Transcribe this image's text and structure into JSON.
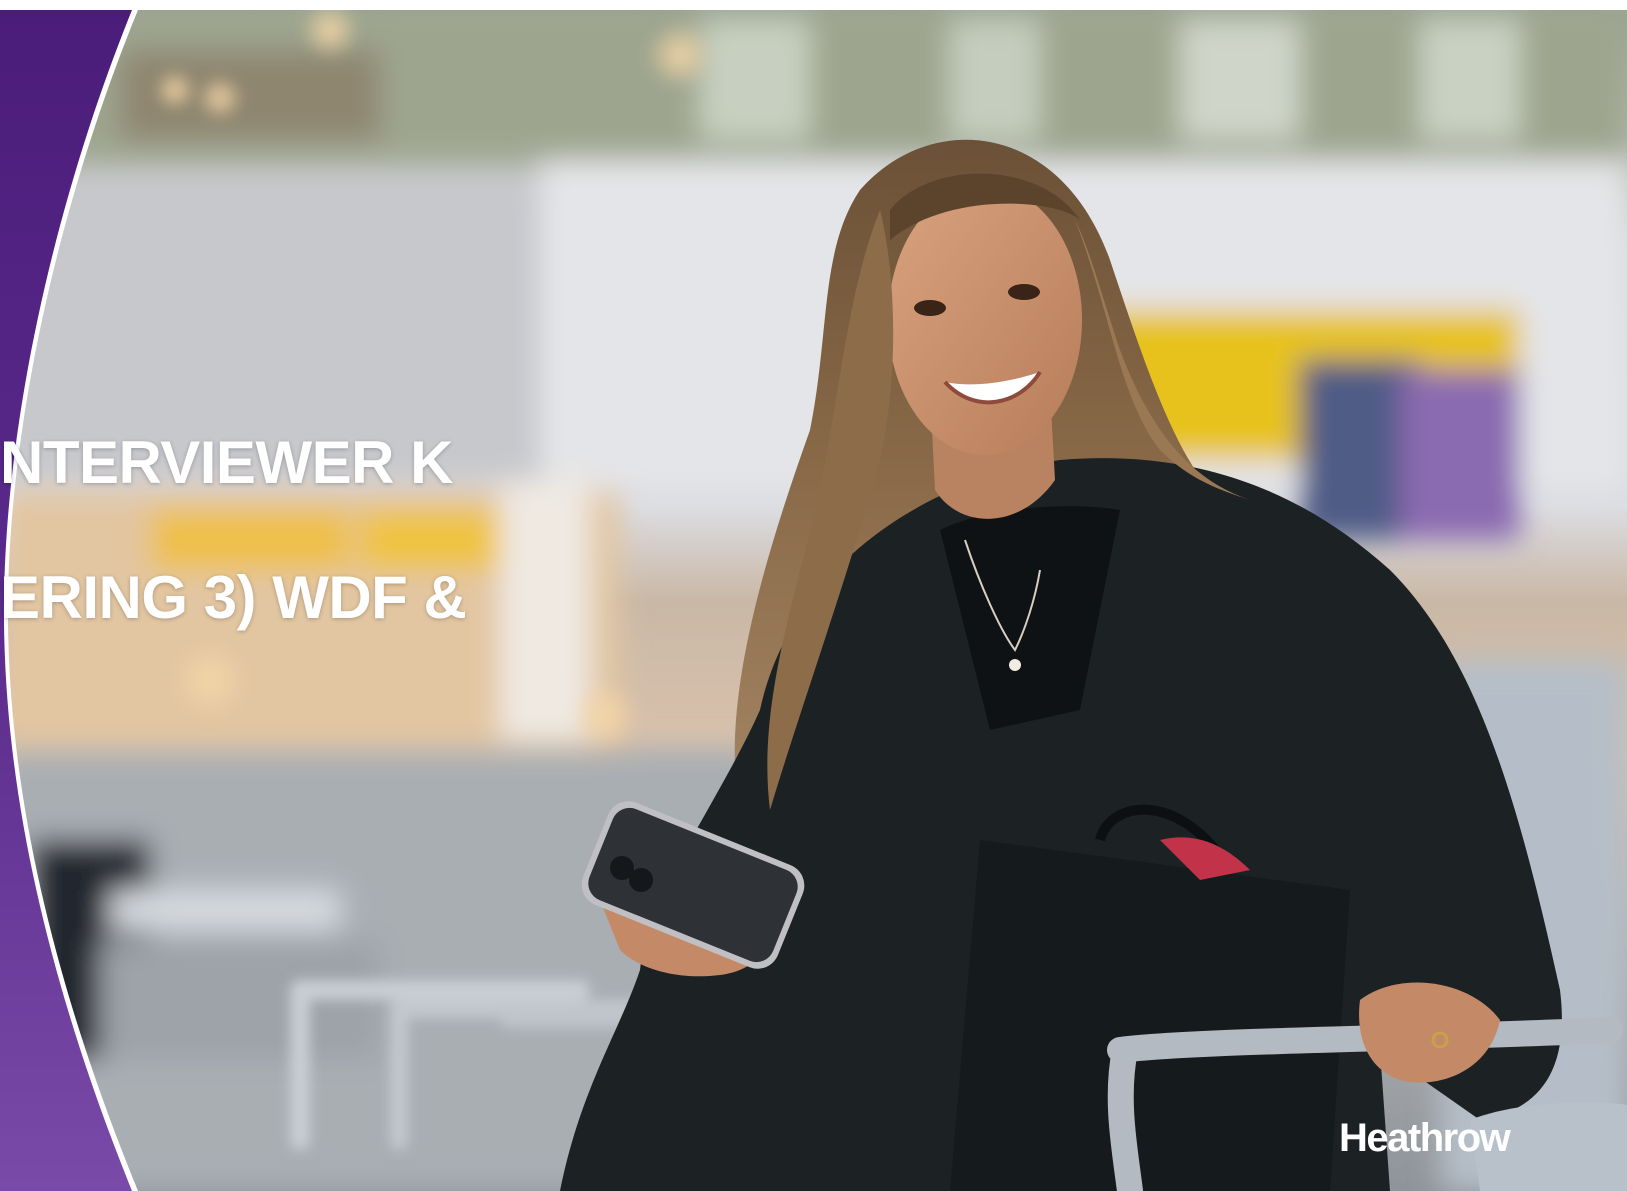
{
  "slide": {
    "headline_line_1": "NTERVIEWER K",
    "headline_line_2": "ERING 3) WDF &"
  },
  "brand": {
    "logo_text": "Heathrow",
    "primary_color": "#4b1d7a",
    "accent_color": "#7a4aa8"
  },
  "photo": {
    "subject": "traveller-with-phone-and-shopping-bag",
    "icon": "photo-icon"
  }
}
